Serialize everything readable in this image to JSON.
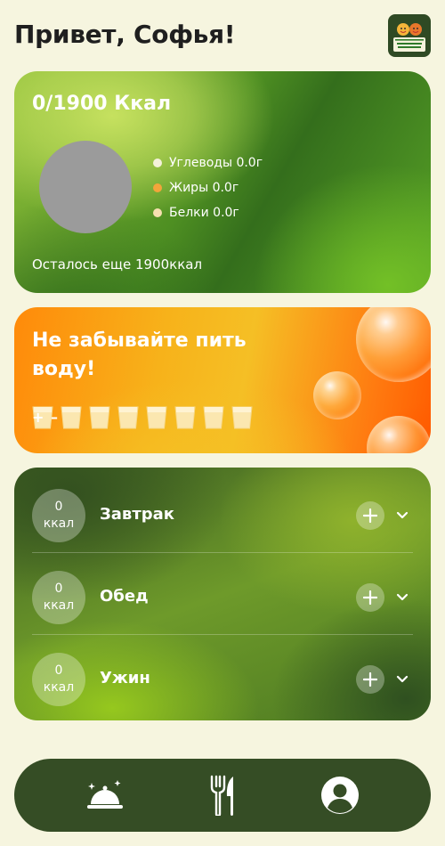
{
  "header": {
    "greeting": "Привет, Софья!",
    "logo_text_line1": "ШКОЛЬНОЕ",
    "logo_text_line2": "ПИТАНИЕ"
  },
  "calories": {
    "title": "0/1900 Ккал",
    "macros": [
      {
        "label": "Углеводы 0.0г",
        "color": "#f4f1da"
      },
      {
        "label": "Жиры 0.0г",
        "color": "#f2a53b"
      },
      {
        "label": "Белки 0.0г",
        "color": "#f6e0b0"
      }
    ],
    "remaining": "Осталось еще 1900ккал"
  },
  "water": {
    "title": "Не забывайте пить воду!",
    "plus": "+",
    "minus": "–",
    "glasses_total": 8,
    "glasses_filled": 0
  },
  "meals": [
    {
      "kcal_value": "0",
      "kcal_unit": "ккал",
      "name": "Завтрак"
    },
    {
      "kcal_value": "0",
      "kcal_unit": "ккал",
      "name": "Обед"
    },
    {
      "kcal_value": "0",
      "kcal_unit": "ккал",
      "name": "Ужин"
    }
  ],
  "nav": [
    {
      "icon": "cloche-icon"
    },
    {
      "icon": "fork-knife-icon"
    },
    {
      "icon": "profile-icon"
    }
  ]
}
